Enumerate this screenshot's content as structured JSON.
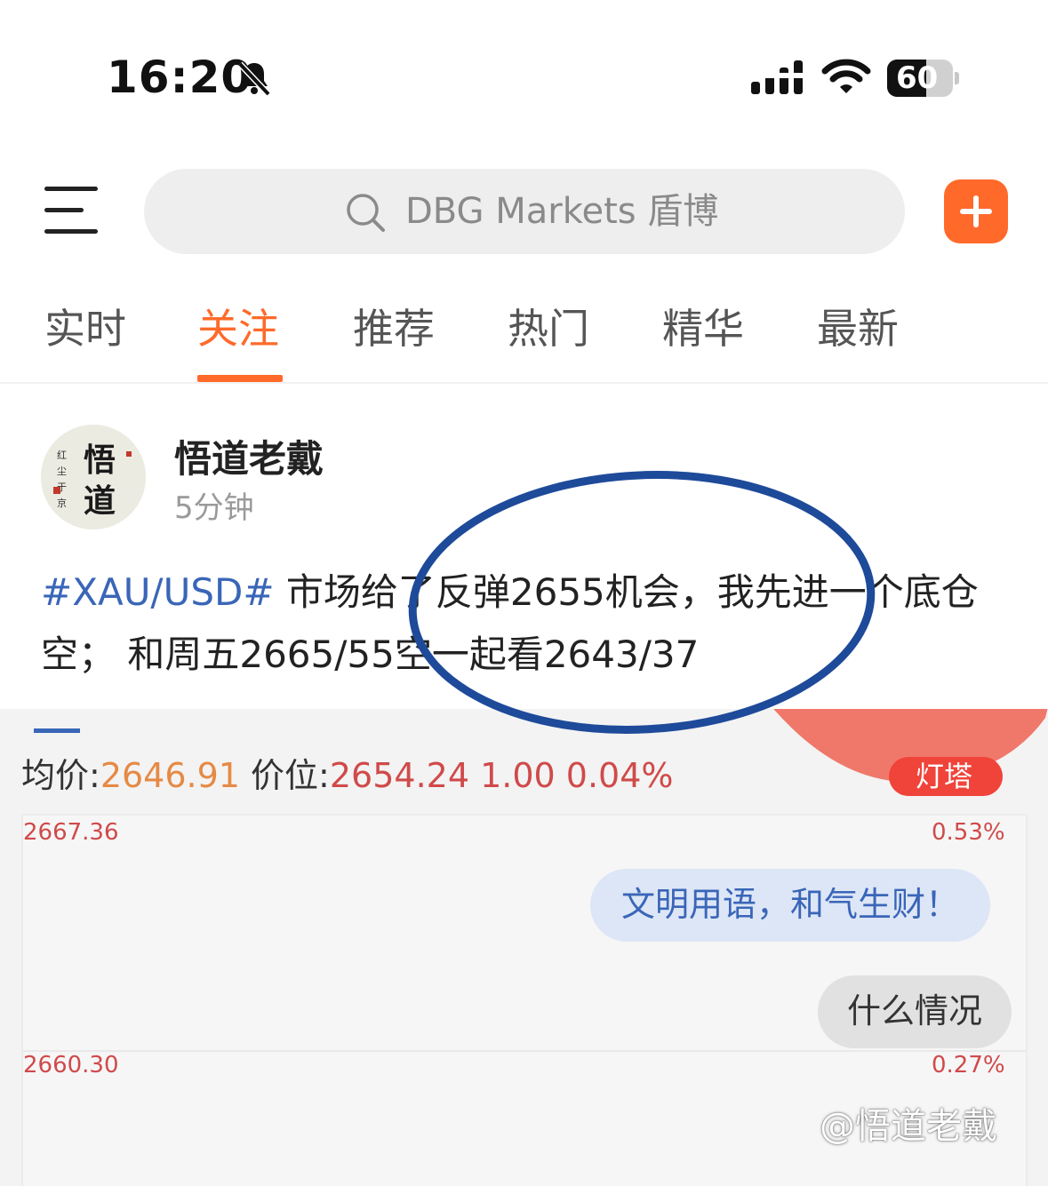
{
  "status_bar": {
    "time": "16:20",
    "battery_level": "60",
    "battery_fraction": 0.6
  },
  "search": {
    "placeholder": "DBG Markets 盾博"
  },
  "tabs": [
    {
      "label": "实时",
      "active": false
    },
    {
      "label": "关注",
      "active": true
    },
    {
      "label": "推荐",
      "active": false
    },
    {
      "label": "热门",
      "active": false
    },
    {
      "label": "精华",
      "active": false
    },
    {
      "label": "最新",
      "active": false
    }
  ],
  "post": {
    "author": "悟道老戴",
    "time": "5分钟",
    "avatar_text": "悟道",
    "hashtag": "#XAU/USD#",
    "body": " 市场给了反弹2655机会，我先进一个底仓空； 和周五2665/55空一起看2643/37"
  },
  "embed": {
    "avg_label": "均价:",
    "avg_value": "2646.91",
    "price_label": "价位:",
    "price_value": "2654.24 1.00 0.04%",
    "badge": "灯塔",
    "ticks_left": [
      "2667.36",
      "2660.30"
    ],
    "ticks_right": [
      "0.53%",
      "0.27%"
    ],
    "bubble_1": "文明用语，和气生财！",
    "bubble_2": "什么情况"
  },
  "watermark": "@悟道老戴",
  "colors": {
    "accent": "#ff6a2b",
    "hashtag": "#3a66b8",
    "circle": "#1e4a9a",
    "price_red": "#d04a4a",
    "avg_orange": "#e58a45"
  }
}
